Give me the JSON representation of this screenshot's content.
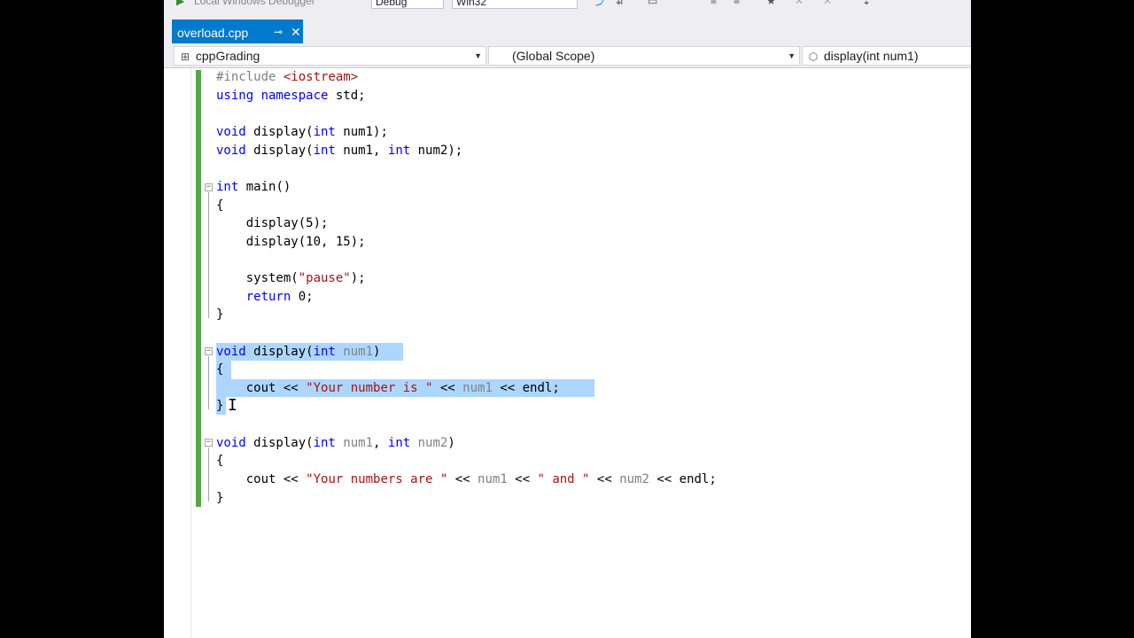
{
  "toolbar_strip": {
    "debugger_label": "Local Windows Debugger",
    "config": "Debug",
    "platform": "Win32"
  },
  "tab": {
    "label": "overload.cpp",
    "pin": "⊸",
    "close": "✕"
  },
  "navbar": {
    "project": "cppGrading",
    "scope": "(Global Scope)",
    "member": "display(int num1)"
  },
  "code": {
    "l1": {
      "a": "#include ",
      "b": "<iostream>"
    },
    "l2": {
      "a": "using namespace",
      "b": " std;"
    },
    "l4": {
      "a": "void",
      "b": " display(",
      "c": "int",
      "d": " num1);"
    },
    "l5": {
      "a": "void",
      "b": " display(",
      "c": "int",
      "d": " num1, ",
      "e": "int",
      "f": " num2);"
    },
    "l7": {
      "a": "int",
      "b": " main()"
    },
    "l8": "{",
    "l9": "    display(5);",
    "l10": "    display(10, 15);",
    "l12": {
      "a": "    system(",
      "b": "\"pause\"",
      "c": ");"
    },
    "l13": {
      "a": "    return",
      "b": " 0;"
    },
    "l14": "}",
    "l16": {
      "a": "void",
      "b": " display(",
      "c": "int",
      "d": " num1",
      "e": ")"
    },
    "l17": "{",
    "l18": {
      "a": "    cout << ",
      "b": "\"Your number is \"",
      "c": " << ",
      "d": "num1",
      "e": " << endl;"
    },
    "l19": "}",
    "l21": {
      "a": "void",
      "b": " display(",
      "c": "int",
      "d": " num1",
      "e": ", ",
      "f": "int",
      "g": " num2",
      "h": ")"
    },
    "l22": "{",
    "l23": {
      "a": "    cout << ",
      "b": "\"Your numbers are \"",
      "c": " << ",
      "d": "num1",
      "e": " << ",
      "f": "\" and \"",
      "g": " << ",
      "h": "num2",
      "i": " << endl;"
    },
    "l24": "}"
  },
  "colors": {
    "accent": "#007acc",
    "keyword": "#0000ff",
    "string": "#a31515",
    "selection": "#add6ff",
    "changebar": "#57a64a"
  }
}
